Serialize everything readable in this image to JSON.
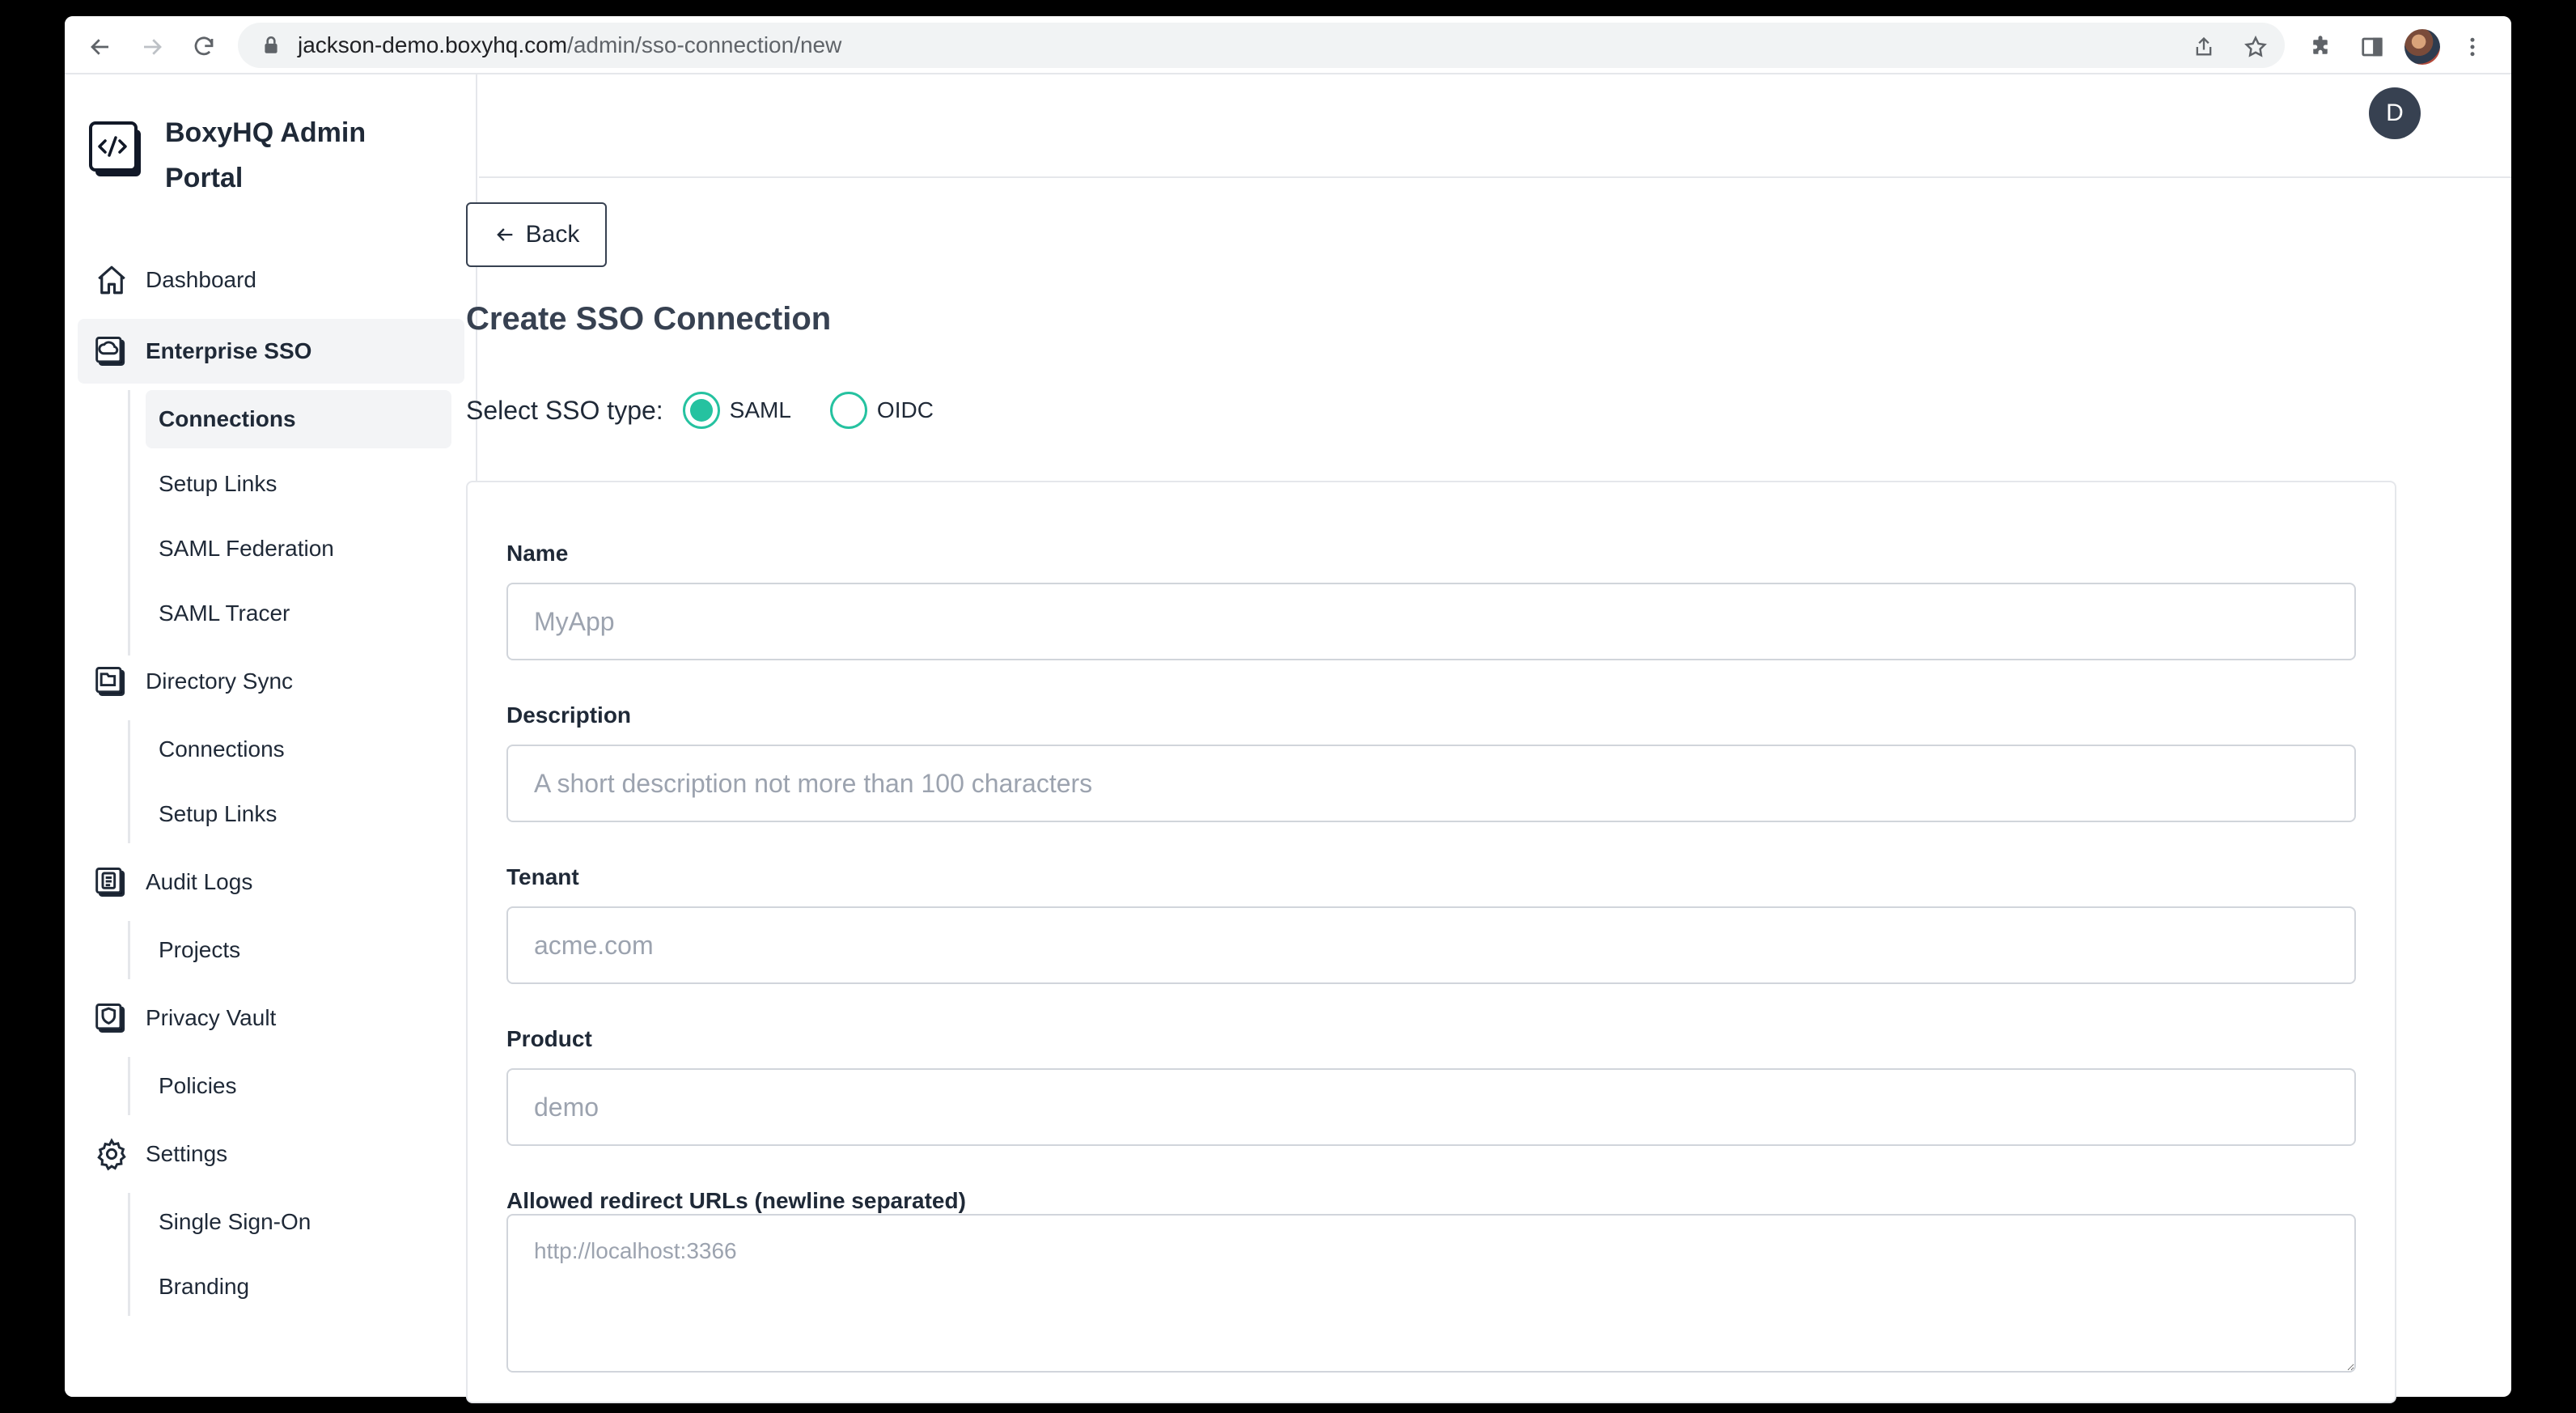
{
  "browser": {
    "url_domain": "jackson-demo.boxyhq.com",
    "url_path": "/admin/sso-connection/new"
  },
  "sidebar": {
    "brand_title": "BoxyHQ Admin Portal",
    "items": [
      {
        "label": "Dashboard"
      },
      {
        "label": "Enterprise SSO",
        "sub": [
          "Connections",
          "Setup Links",
          "SAML Federation",
          "SAML Tracer"
        ]
      },
      {
        "label": "Directory Sync",
        "sub": [
          "Connections",
          "Setup Links"
        ]
      },
      {
        "label": "Audit Logs",
        "sub": [
          "Projects"
        ]
      },
      {
        "label": "Privacy Vault",
        "sub": [
          "Policies"
        ]
      },
      {
        "label": "Settings",
        "sub": [
          "Single Sign-On",
          "Branding"
        ]
      }
    ]
  },
  "header": {
    "avatar_initial": "D"
  },
  "main": {
    "back_label": "Back",
    "title": "Create SSO Connection",
    "sso_type_label": "Select SSO type:",
    "sso_options": [
      "SAML",
      "OIDC"
    ],
    "selected_sso": "SAML",
    "fields": {
      "name": {
        "label": "Name",
        "placeholder": "MyApp",
        "value": ""
      },
      "description": {
        "label": "Description",
        "placeholder": "A short description not more than 100 characters",
        "value": ""
      },
      "tenant": {
        "label": "Tenant",
        "placeholder": "acme.com",
        "value": ""
      },
      "product": {
        "label": "Product",
        "placeholder": "demo",
        "value": ""
      },
      "redirect_urls": {
        "label": "Allowed redirect URLs (newline separated)",
        "placeholder": "http://localhost:3366",
        "value": ""
      }
    }
  },
  "colors": {
    "accent": "#25c2a0",
    "active_bg": "#f3f4f6",
    "border": "#d1d5db"
  }
}
